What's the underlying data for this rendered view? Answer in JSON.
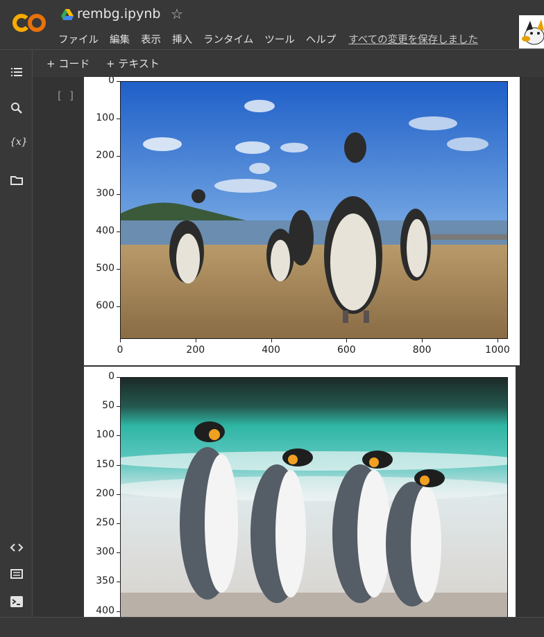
{
  "header": {
    "title": "rembg.ipynb",
    "menu": [
      "ファイル",
      "編集",
      "表示",
      "挿入",
      "ランタイム",
      "ツール",
      "ヘルプ"
    ],
    "save_status": "すべての変更を保存しました"
  },
  "toolbar": {
    "add_code": "+ コード",
    "add_text": "+ テキスト"
  },
  "cell": {
    "run_indicator": "[ ]"
  },
  "sidebar_icons": [
    "table-of-contents-icon",
    "search-icon",
    "variables-icon",
    "files-icon",
    "code-snippets-icon",
    "command-palette-icon",
    "terminal-icon"
  ],
  "colors": {
    "background": "#383838",
    "logo_orange": "#f9ab00",
    "logo_dark_orange": "#e8710a"
  },
  "chart_data": [
    {
      "type": "image",
      "description_of_content": "photo of Humboldt penguins on a beach",
      "x_ticks": [
        "0",
        "200",
        "400",
        "600",
        "800",
        "1000"
      ],
      "y_ticks": [
        "0",
        "100",
        "200",
        "300",
        "400",
        "500",
        "600"
      ],
      "xlim": [
        0,
        1024
      ],
      "ylim": [
        683,
        0
      ]
    },
    {
      "type": "image",
      "description_of_content": "photo of king penguins by the sea",
      "x_ticks": [],
      "y_ticks": [
        "0",
        "50",
        "100",
        "150",
        "200",
        "250",
        "300",
        "350",
        "400"
      ],
      "ylim": [
        410,
        0
      ]
    }
  ]
}
